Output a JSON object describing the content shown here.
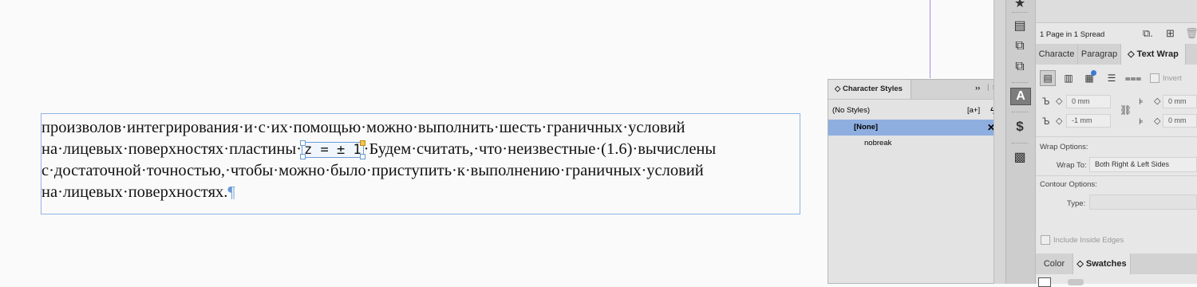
{
  "document": {
    "lines": [
      "произволов·интегрирования·и·с·их·помощью·можно·выполнить·шесть·граничных·условий",
      "на·лицевых·поверхностях·пластины·",
      "·Будем·считать,·что·неизвестные·(1.6)·вычислены",
      "с·достаточной·точностью,·чтобы·можно·было·приступить·к·выполнению·граничных·условий",
      "на·лицевых·поверхностях."
    ],
    "inline_object": "z = ± 1",
    "pilcrow": "¶"
  },
  "character_styles": {
    "title": "Character Styles",
    "header_left": "(No Styles)",
    "items": [
      "[None]",
      "nobreak"
    ]
  },
  "pages_panel": {
    "status": "1 Page in 1 Spread"
  },
  "tabs": {
    "upper": [
      "Characte",
      "Paragrap",
      "Text Wrap"
    ],
    "lower": [
      "Color",
      "Swatches"
    ]
  },
  "text_wrap": {
    "invert_label": "Invert",
    "top_offset": "0 mm",
    "bottom_offset": "-1 mm",
    "left_offset": "0 mm",
    "right_offset": "0 mm",
    "wrap_options_label": "Wrap Options:",
    "wrap_to_label": "Wrap To:",
    "wrap_to_value": "Both Right & Left Sides",
    "contour_options_label": "Contour Options:",
    "type_label": "Type:",
    "include_inside_edges": "Include Inside Edges"
  },
  "colors": {
    "selection": "#8eaee0",
    "accent_blue": "#3a7bd5",
    "guide": "#a98be8"
  }
}
